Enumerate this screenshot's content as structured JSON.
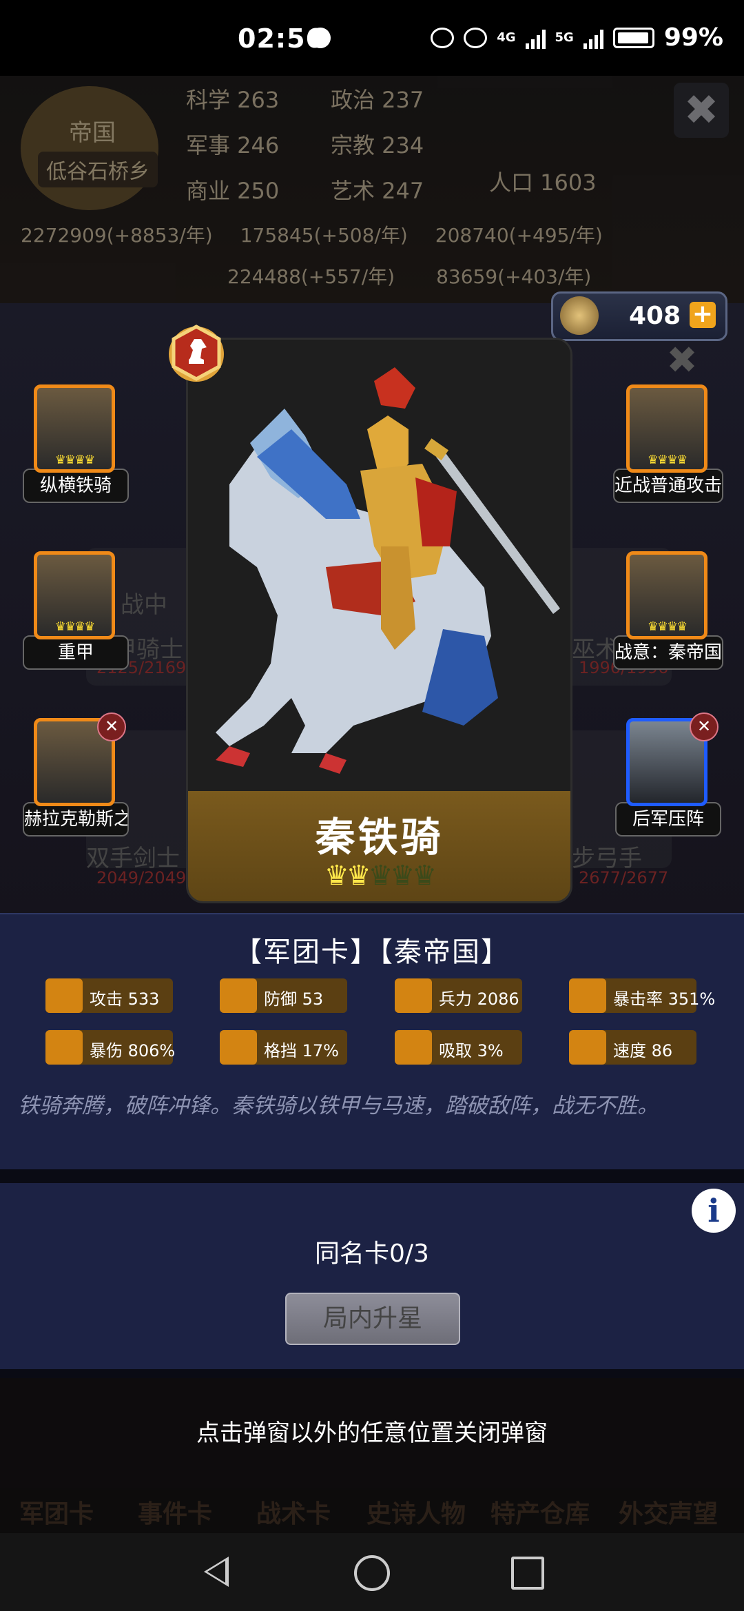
{
  "status_bar": {
    "time": "02:56",
    "battery": "99%",
    "net1": "4G",
    "net2": "5G"
  },
  "background": {
    "emblem_label": "帝国",
    "town": "低谷石桥乡",
    "stats": [
      "科学 263",
      "政治 237",
      "军事 246",
      "宗教 234",
      "商业 250",
      "艺术 247"
    ],
    "population": "人口 1603",
    "resources_row1": [
      "2272909(+8853/年)",
      "175845(+508/年)",
      "208740(+495/年)"
    ],
    "resources_row2": [
      "224488(+557/年)",
      "83659(+403/年)"
    ],
    "bg_captions": [
      "战中",
      "轻甲骑士",
      "巫术医师",
      "双手剑士",
      "步弓手"
    ],
    "bg_hp": [
      "2125/2169",
      "1996/1996",
      "2049/2049",
      "2677/2677"
    ],
    "bg_hint": "点击弹窗以外的任意位置关闭弹窗",
    "tabs": [
      "军团卡",
      "事件卡",
      "战术卡",
      "史诗人物",
      "特产仓库",
      "外交声望"
    ]
  },
  "badge": {
    "count": "408",
    "plus": "+"
  },
  "popup_close": "✖",
  "skills_left": [
    {
      "name": "纵横铁骑",
      "crowns": "♛♛♛♛"
    },
    {
      "name": "重甲",
      "crowns": "♛♛♛♛"
    },
    {
      "name": "赫拉克勒斯之",
      "crowns": "",
      "removable": true
    }
  ],
  "skills_right": [
    {
      "name": "近战普通攻击",
      "crowns": "♛♛♛♛"
    },
    {
      "name": "战意：秦帝国",
      "crowns": "♛♛♛♛"
    },
    {
      "name": "后军压阵",
      "crowns": "",
      "removable": true
    }
  ],
  "card": {
    "name": "秦铁骑",
    "stars_total": 5,
    "stars_filled": 2,
    "star_glyph": "♛"
  },
  "info": {
    "title": "【军团卡】【秦帝国】",
    "stats": [
      {
        "label": "攻击 533",
        "icon": "sword-icon"
      },
      {
        "label": "防御 53",
        "icon": "shield-icon"
      },
      {
        "label": "兵力 2086",
        "icon": "heart-icon"
      },
      {
        "label": "暴击率 351%",
        "icon": "crit-target-icon"
      },
      {
        "label": "暴伤 806%",
        "icon": "crit-damage-icon"
      },
      {
        "label": "格挡 17%",
        "icon": "block-icon"
      },
      {
        "label": "吸取 3%",
        "icon": "lifesteal-icon"
      },
      {
        "label": "速度 86",
        "icon": "boot-icon"
      }
    ],
    "description": "铁骑奔腾，破阵冲锋。秦铁骑以铁甲与马速，踏破敌阵，战无不胜。"
  },
  "upgrade": {
    "info_icon": "i",
    "same_card": "同名卡0/3",
    "button": "局内升星"
  },
  "close_hint": "点击弹窗以外的任意位置关闭弹窗",
  "colors": {
    "accent_orange": "#f08a18",
    "panel_blue": "#1c2244",
    "gold": "#ffe74a"
  }
}
